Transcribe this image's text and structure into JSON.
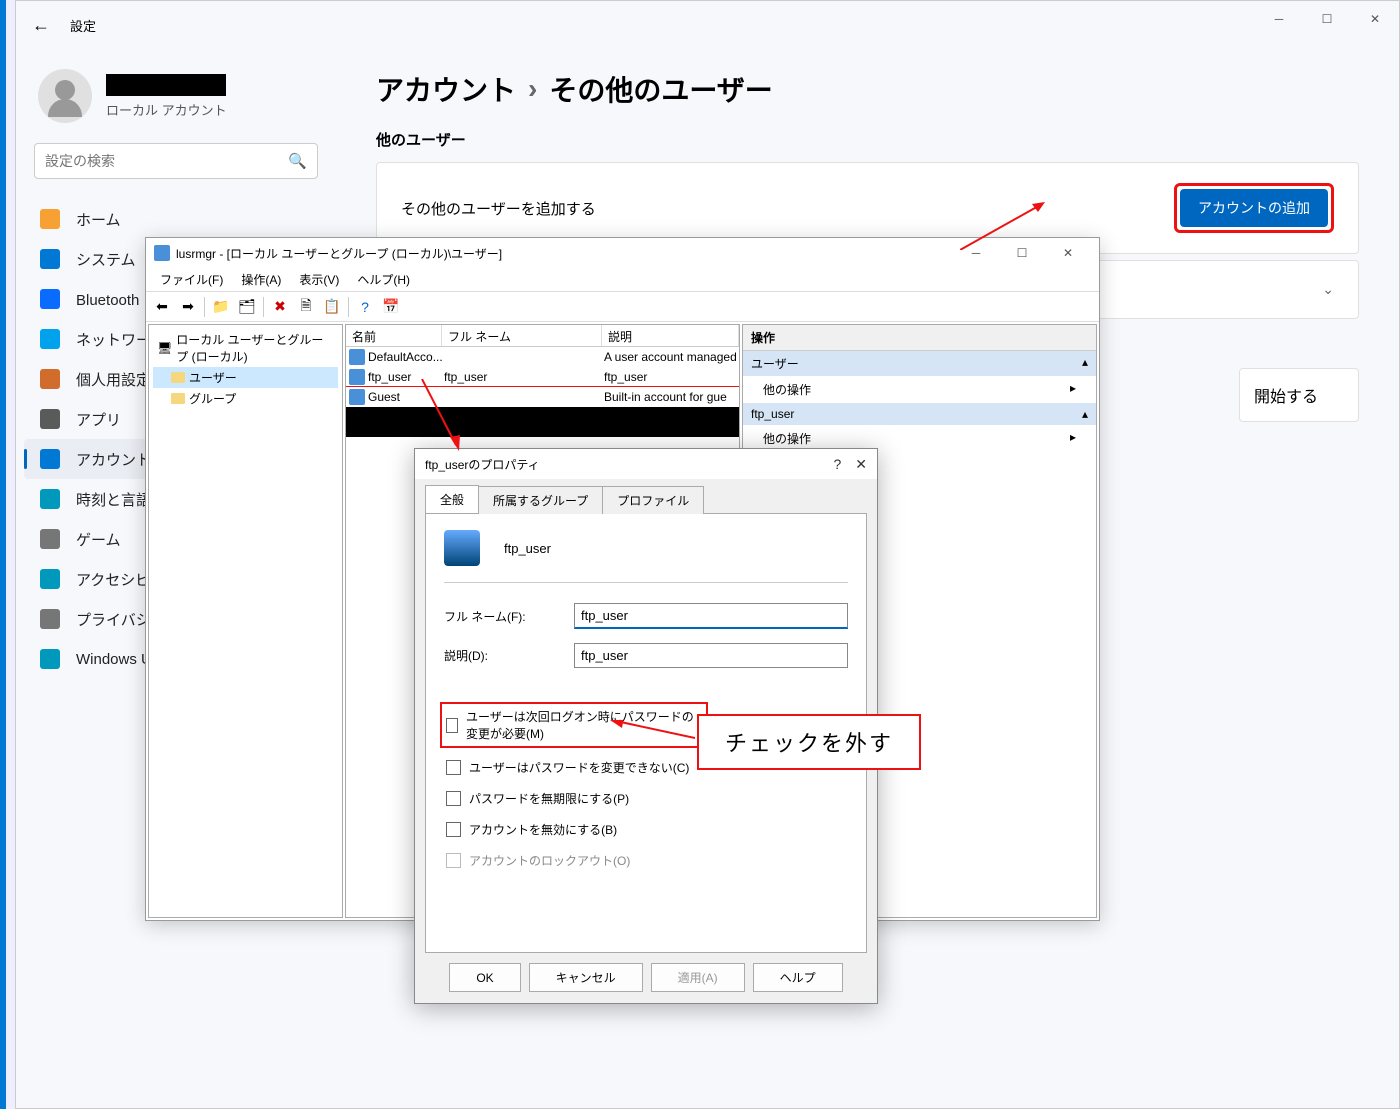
{
  "settings": {
    "title": "設定",
    "user_sub": "ローカル アカウント",
    "search_placeholder": "設定の検索",
    "nav": [
      {
        "icon": "home",
        "label": "ホーム",
        "color": "#f7a033"
      },
      {
        "icon": "system",
        "label": "システム",
        "color": "#0078d4"
      },
      {
        "icon": "bluetooth",
        "label": "Bluetooth と",
        "color": "#0a6cff"
      },
      {
        "icon": "network",
        "label": "ネットワークと",
        "color": "#00a2ed"
      },
      {
        "icon": "personal",
        "label": "個人用設定",
        "color": "#d06c2c"
      },
      {
        "icon": "apps",
        "label": "アプリ",
        "color": "#5a5a5a"
      },
      {
        "icon": "account",
        "label": "アカウント",
        "color": "#0078d4",
        "active": true
      },
      {
        "icon": "time",
        "label": "時刻と言語",
        "color": "#0099bc"
      },
      {
        "icon": "game",
        "label": "ゲーム",
        "color": "#767676"
      },
      {
        "icon": "access",
        "label": "アクセシビリテ",
        "color": "#0099bc"
      },
      {
        "icon": "privacy",
        "label": "プライバシーと",
        "color": "#767676"
      },
      {
        "icon": "update",
        "label": "Windows U",
        "color": "#0099bc"
      }
    ],
    "breadcrumb": {
      "a": "アカウント",
      "b": "その他のユーザー"
    },
    "section_other": "他のユーザー",
    "card_add_text": "その他のユーザーを追加する",
    "add_btn": "アカウントの追加",
    "card_signin": "開始する"
  },
  "lusrmgr": {
    "title": "lusrmgr - [ローカル ユーザーとグループ (ローカル)\\ユーザー]",
    "menu": [
      "ファイル(F)",
      "操作(A)",
      "表示(V)",
      "ヘルプ(H)"
    ],
    "tree_root": "ローカル ユーザーとグループ (ローカル)",
    "tree_users": "ユーザー",
    "tree_groups": "グループ",
    "cols": {
      "name": "名前",
      "full": "フル ネーム",
      "desc": "説明"
    },
    "rows": [
      {
        "name": "DefaultAcco...",
        "full": "",
        "desc": "A user account managed"
      },
      {
        "name": "ftp_user",
        "full": "ftp_user",
        "desc": "ftp_user",
        "hl": true
      },
      {
        "name": "Guest",
        "full": "",
        "desc": "Built-in account for gue"
      }
    ],
    "actions_title": "操作",
    "act_users": "ユーザー",
    "act_more": "他の操作",
    "act_ftp": "ftp_user"
  },
  "props": {
    "title": "ftp_userのプロパティ",
    "tabs": [
      "全般",
      "所属するグループ",
      "プロファイル"
    ],
    "username": "ftp_user",
    "full_label": "フル ネーム(F):",
    "full_value": "ftp_user",
    "desc_label": "説明(D):",
    "desc_value": "ftp_user",
    "chk1": "ユーザーは次回ログオン時にパスワードの変更が必要(M)",
    "chk2": "ユーザーはパスワードを変更できない(C)",
    "chk3": "パスワードを無期限にする(P)",
    "chk4": "アカウントを無効にする(B)",
    "chk5": "アカウントのロックアウト(O)",
    "btn_ok": "OK",
    "btn_cancel": "キャンセル",
    "btn_apply": "適用(A)",
    "btn_help": "ヘルプ"
  },
  "callout": "チェックを外す"
}
